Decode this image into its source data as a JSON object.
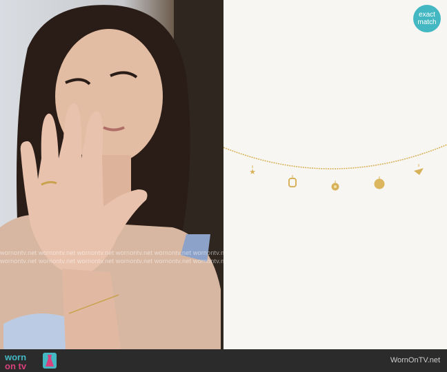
{
  "watermark": {
    "rows": [
      "wornontv.net wornontv.net wornontv.net wornontv.net wornontv.net wornontv.net",
      "wornontv.net wornontv.net wornontv.net wornontv.net wornontv.net wornontv.net"
    ]
  },
  "badge": {
    "line1": "exact",
    "line2": "match",
    "color": "#43b8c2"
  },
  "footer": {
    "logo_top": "worn",
    "logo_bottom": "on tv",
    "site": "WornOnTV.net",
    "logo_colors": {
      "worn": "#43b8c2",
      "on": "#d9417c",
      "tv": "#43b8c2"
    }
  },
  "product": {
    "name": "gold charm necklace",
    "metal_color": "#d8b25a"
  },
  "icons": [
    "dress-icon"
  ]
}
